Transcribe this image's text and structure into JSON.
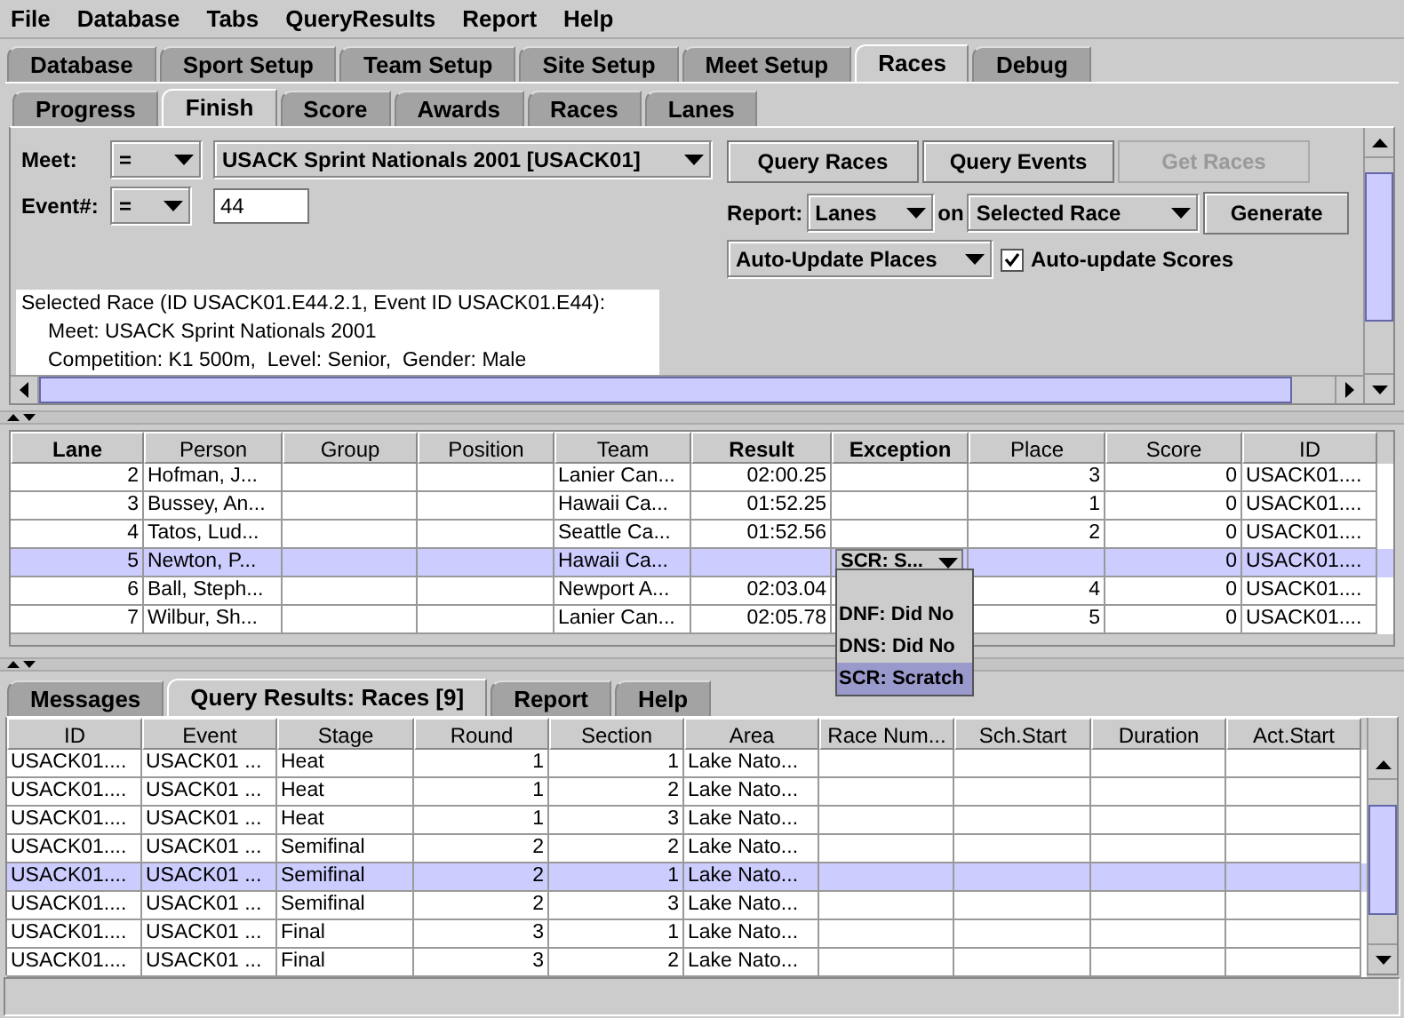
{
  "menu": [
    "File",
    "Database",
    "Tabs",
    "QueryResults",
    "Report",
    "Help"
  ],
  "main_tabs": [
    {
      "label": "Database",
      "selected": false
    },
    {
      "label": "Sport Setup",
      "selected": false
    },
    {
      "label": "Team Setup",
      "selected": false
    },
    {
      "label": "Site Setup",
      "selected": false
    },
    {
      "label": "Meet Setup",
      "selected": false
    },
    {
      "label": "Races",
      "selected": true
    },
    {
      "label": "Debug",
      "selected": false
    }
  ],
  "sub_tabs": [
    {
      "label": "Progress",
      "selected": false
    },
    {
      "label": "Finish",
      "selected": true
    },
    {
      "label": "Score",
      "selected": false
    },
    {
      "label": "Awards",
      "selected": false
    },
    {
      "label": "Races",
      "selected": false
    },
    {
      "label": "Lanes",
      "selected": false
    }
  ],
  "query_panel": {
    "meet_label": "Meet:",
    "meet_operator": "=",
    "meet_value": "USACK Sprint Nationals 2001 [USACK01]",
    "event_label": "Event#:",
    "event_operator": "=",
    "event_value": "44",
    "buttons": [
      {
        "label": "Query Races",
        "disabled": false
      },
      {
        "label": "Query Events",
        "disabled": false
      },
      {
        "label": "Get Races",
        "disabled": true
      }
    ],
    "report_label": "Report:",
    "report_value": "Lanes",
    "on_label": "on",
    "target_value": "Selected Race",
    "generate_button": "Generate",
    "auto_update_places": "Auto-Update Places",
    "auto_update_scores": {
      "label": "Auto-update Scores",
      "checked": true
    },
    "info": {
      "title": "Selected Race (ID USACK01.E44.2.1, Event ID USACK01.E44):",
      "lines": [
        "Meet: USACK Sprint Nationals 2001",
        "Competition: K1 500m,  Level: Senior,  Gender: Male"
      ]
    }
  },
  "lanes_table": {
    "columns": [
      {
        "label": "Lane",
        "bold": true,
        "kind": "number"
      },
      {
        "label": "Person",
        "bold": false,
        "kind": "text"
      },
      {
        "label": "Group",
        "bold": false,
        "kind": "text"
      },
      {
        "label": "Position",
        "bold": false,
        "kind": "text"
      },
      {
        "label": "Team",
        "bold": false,
        "kind": "text"
      },
      {
        "label": "Result",
        "bold": true,
        "kind": "number"
      },
      {
        "label": "Exception",
        "bold": true,
        "kind": "combo"
      },
      {
        "label": "Place",
        "bold": false,
        "kind": "number"
      },
      {
        "label": "Score",
        "bold": false,
        "kind": "number"
      },
      {
        "label": "ID",
        "bold": false,
        "kind": "text"
      }
    ],
    "rows": [
      {
        "selected": false,
        "cells": [
          "2",
          "Hofman, J...",
          null,
          null,
          "Lanier Can...",
          "02:00.25",
          null,
          "3",
          "0",
          "USACK01...."
        ]
      },
      {
        "selected": false,
        "cells": [
          "3",
          "Bussey, An...",
          null,
          null,
          "Hawaii Ca...",
          "01:52.25",
          null,
          "1",
          "0",
          "USACK01...."
        ]
      },
      {
        "selected": false,
        "cells": [
          "4",
          "Tatos, Lud...",
          null,
          null,
          "Seattle Ca...",
          "01:52.56",
          null,
          "2",
          "0",
          "USACK01...."
        ]
      },
      {
        "selected": true,
        "editor": "SCR: S...",
        "cells": [
          "5",
          "Newton, P...",
          null,
          null,
          "Hawaii Ca...",
          null,
          null,
          null,
          "0",
          "USACK01...."
        ]
      },
      {
        "selected": false,
        "cells": [
          "6",
          "Ball, Steph...",
          null,
          null,
          "Newport A...",
          "02:03.04",
          null,
          "4",
          "0",
          "USACK01...."
        ]
      },
      {
        "selected": false,
        "cells": [
          "7",
          "Wilbur, Sh...",
          null,
          null,
          "Lanier Can...",
          "02:05.78",
          null,
          "5",
          "0",
          "USACK01...."
        ]
      }
    ]
  },
  "exception_popup": {
    "items": [
      {
        "label": "DNF: Did No",
        "selected": false
      },
      {
        "label": "DNS: Did No",
        "selected": false
      },
      {
        "label": "SCR: Scratch",
        "selected": true
      }
    ]
  },
  "bottom_tabs": [
    {
      "label": "Messages",
      "selected": false
    },
    {
      "label": "Query Results: Races [9]",
      "selected": true
    },
    {
      "label": "Report",
      "selected": false
    },
    {
      "label": "Help",
      "selected": false
    }
  ],
  "results_table": {
    "columns": [
      {
        "label": "ID",
        "kind": "text"
      },
      {
        "label": "Event",
        "kind": "text"
      },
      {
        "label": "Stage",
        "kind": "text"
      },
      {
        "label": "Round",
        "kind": "number"
      },
      {
        "label": "Section",
        "kind": "number"
      },
      {
        "label": "Area",
        "kind": "text"
      },
      {
        "label": "Race Num...",
        "kind": "text"
      },
      {
        "label": "Sch.Start",
        "kind": "text"
      },
      {
        "label": "Duration",
        "kind": "text"
      },
      {
        "label": "Act.Start",
        "kind": "text"
      }
    ],
    "rows": [
      {
        "selected": false,
        "cells": [
          "USACK01....",
          "USACK01 ...",
          "Heat",
          "1",
          "1",
          "Lake Nato..."
        ]
      },
      {
        "selected": false,
        "cells": [
          "USACK01....",
          "USACK01 ...",
          "Heat",
          "1",
          "2",
          "Lake Nato..."
        ]
      },
      {
        "selected": false,
        "cells": [
          "USACK01....",
          "USACK01 ...",
          "Heat",
          "1",
          "3",
          "Lake Nato..."
        ]
      },
      {
        "selected": false,
        "cells": [
          "USACK01....",
          "USACK01 ...",
          "Semifinal",
          "2",
          "2",
          "Lake Nato..."
        ]
      },
      {
        "selected": true,
        "cells": [
          "USACK01....",
          "USACK01 ...",
          "Semifinal",
          "2",
          "1",
          "Lake Nato..."
        ]
      },
      {
        "selected": false,
        "cells": [
          "USACK01....",
          "USACK01 ...",
          "Semifinal",
          "2",
          "3",
          "Lake Nato..."
        ]
      },
      {
        "selected": false,
        "cells": [
          "USACK01....",
          "USACK01 ...",
          "Final",
          "3",
          "1",
          "Lake Nato..."
        ]
      },
      {
        "selected": false,
        "cells": [
          "USACK01....",
          "USACK01 ...",
          "Final",
          "3",
          "2",
          "Lake Nato..."
        ]
      }
    ]
  }
}
